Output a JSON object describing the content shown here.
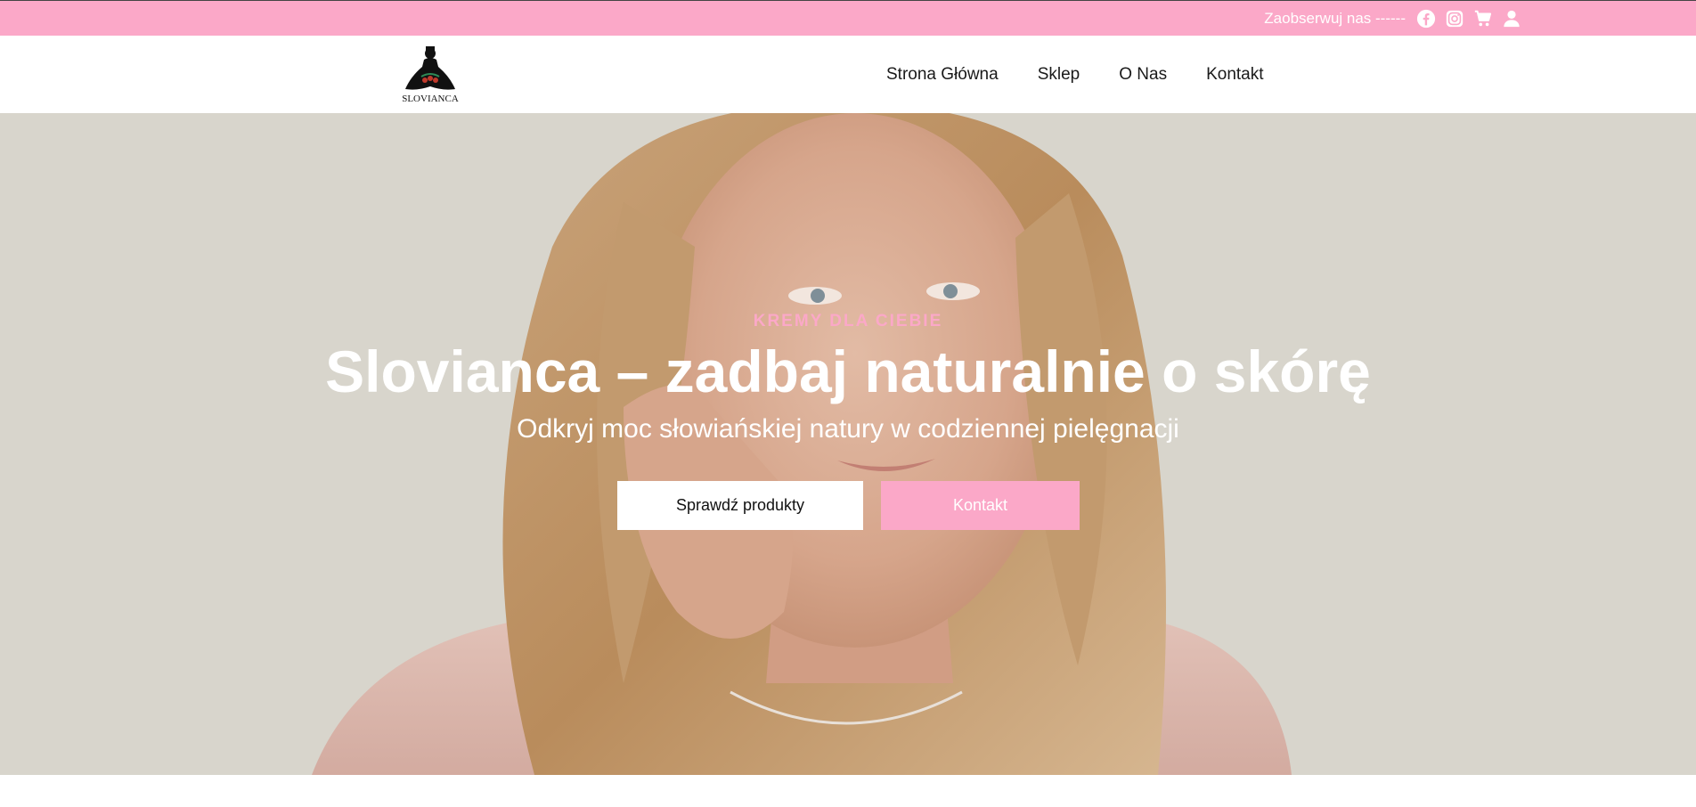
{
  "topbar": {
    "follow_label": "Zaobserwuj nas ------",
    "icons": [
      "facebook-icon",
      "instagram-icon",
      "cart-icon",
      "user-icon"
    ]
  },
  "brand": {
    "logo_text": "SLOVIANCA"
  },
  "nav": {
    "items": [
      {
        "label": "Strona Główna"
      },
      {
        "label": "Sklep"
      },
      {
        "label": "O Nas"
      },
      {
        "label": "Kontakt"
      }
    ]
  },
  "hero": {
    "eyebrow": "KREMY DLA CIEBIE",
    "title": "Slovianca – zadbaj naturalnie o skórę",
    "subtitle": "Odkryj moc słowiańskiej natury w codziennej pielęgnacji",
    "cta_primary": "Sprawdź produkty",
    "cta_secondary": "Kontakt"
  },
  "colors": {
    "accent_pink": "#fba8c8",
    "hero_background": "#d8d5cc",
    "text_dark": "#1a1a1a"
  }
}
